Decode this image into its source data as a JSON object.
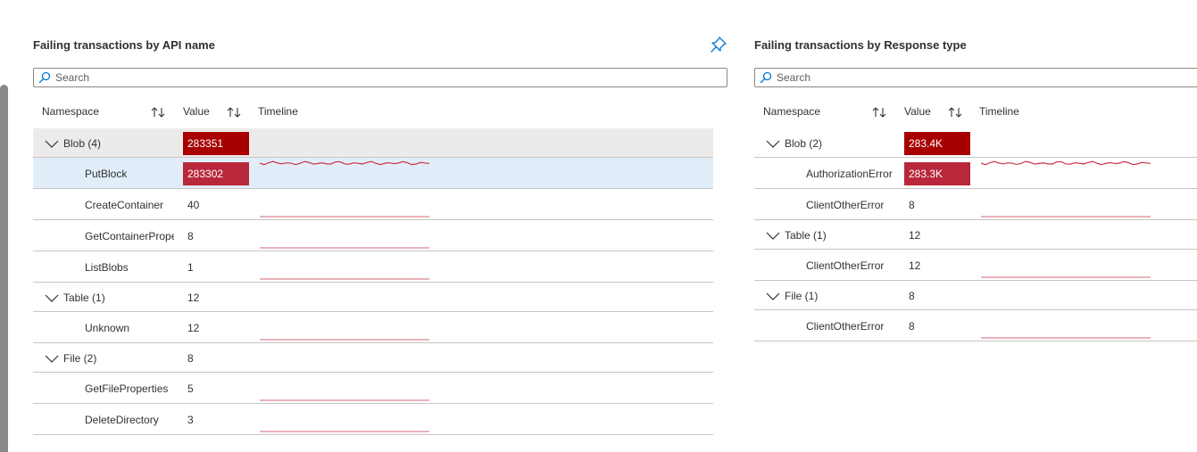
{
  "colors": {
    "accent_red_dark": "#a80000",
    "accent_red": "#b8283a",
    "spark_red": "#c8344a",
    "pin_blue": "#0078d4"
  },
  "left_panel": {
    "title": "Failing transactions by API name",
    "search_placeholder": "Search",
    "columns": {
      "namespace": "Namespace",
      "value": "Value",
      "timeline": "Timeline"
    },
    "rows": [
      {
        "type": "group",
        "label": "Blob (4)",
        "value": "283351",
        "bar": true,
        "bar_color": "#a80000",
        "highlight": "group"
      },
      {
        "type": "item",
        "label": "PutBlock",
        "value": "283302",
        "bar": true,
        "bar_color": "#b8283a",
        "highlight": "selected",
        "timeline": "active"
      },
      {
        "type": "item",
        "label": "CreateContainer",
        "value": "40",
        "timeline": "flat"
      },
      {
        "type": "item",
        "label": "GetContainerProperties",
        "value": "8",
        "timeline": "flat"
      },
      {
        "type": "item",
        "label": "ListBlobs",
        "value": "1",
        "timeline": "flat"
      },
      {
        "type": "group",
        "label": "Table (1)",
        "value": "12"
      },
      {
        "type": "item",
        "label": "Unknown",
        "value": "12",
        "timeline": "flat"
      },
      {
        "type": "group",
        "label": "File (2)",
        "value": "8"
      },
      {
        "type": "item",
        "label": "GetFileProperties",
        "value": "5",
        "timeline": "flat"
      },
      {
        "type": "item",
        "label": "DeleteDirectory",
        "value": "3",
        "timeline": "flat"
      }
    ]
  },
  "right_panel": {
    "title": "Failing transactions by Response type",
    "search_placeholder": "Search",
    "columns": {
      "namespace": "Namespace",
      "value": "Value",
      "timeline": "Timeline"
    },
    "rows": [
      {
        "type": "group",
        "label": "Blob (2)",
        "value": "283.4K",
        "bar": true,
        "bar_color": "#a80000"
      },
      {
        "type": "item",
        "label": "AuthorizationError",
        "value": "283.3K",
        "bar": true,
        "bar_color": "#b8283a",
        "timeline": "active"
      },
      {
        "type": "item",
        "label": "ClientOtherError",
        "value": "8",
        "timeline": "flat"
      },
      {
        "type": "group",
        "label": "Table (1)",
        "value": "12"
      },
      {
        "type": "item",
        "label": "ClientOtherError",
        "value": "12",
        "timeline": "flat"
      },
      {
        "type": "group",
        "label": "File (1)",
        "value": "8"
      },
      {
        "type": "item",
        "label": "ClientOtherError",
        "value": "8",
        "timeline": "flat"
      }
    ]
  }
}
